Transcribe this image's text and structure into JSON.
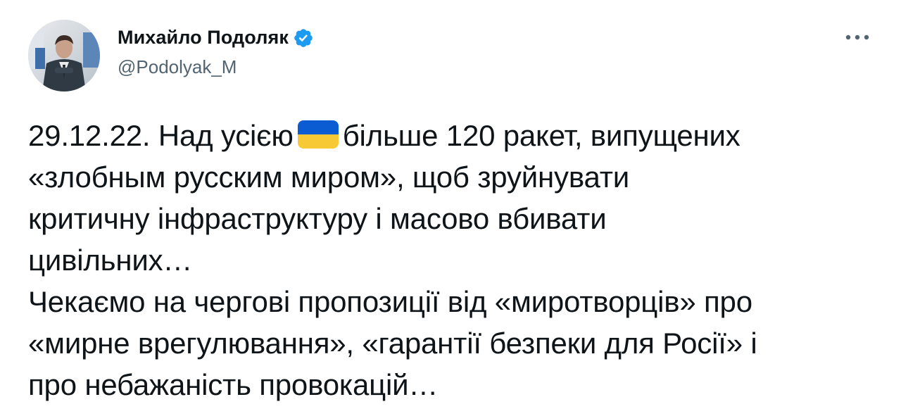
{
  "tweet": {
    "author": {
      "display_name": "Михайло Подоляк",
      "handle": "@Podolyak_M",
      "verified": true,
      "verified_icon": "verified-badge-icon",
      "verified_color": "#1d9bf0",
      "avatar_icon": "avatar-photo"
    },
    "more_icon": "more-options-icon",
    "text": {
      "line1_before": "29.12.22. Над усією",
      "line1_emoji": "ukraine-flag-icon",
      "line1_after": "більше 120 ракет, випущених",
      "line2": "«злобным русским миром», щоб зруйнувати",
      "line3": "критичну інфраструктуру і масово вбивати",
      "line4": "цивільних…",
      "line5": "Чекаємо на чергові пропозиції від «миротворців» про",
      "line6": "«мирне врегулювання», «гарантії безпеки для Росії» і",
      "line7": "про небажаність провокацій…"
    },
    "colors": {
      "text": "#0f1419",
      "secondary": "#536471",
      "flag_blue": "#0b5bd3",
      "flag_yellow": "#f7c934"
    }
  }
}
